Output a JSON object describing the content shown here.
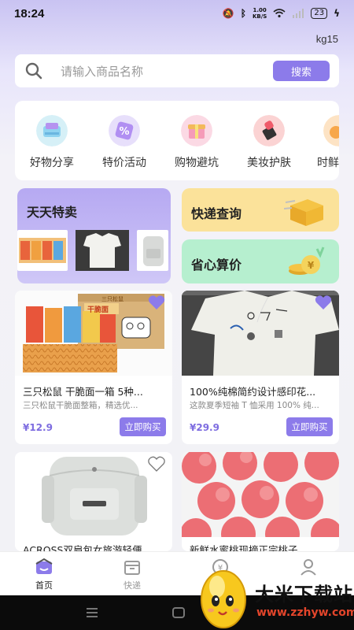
{
  "status": {
    "time": "18:24",
    "speed_value": "1.00",
    "speed_unit": "KB/S",
    "battery": "23"
  },
  "header": {
    "username": "kg15"
  },
  "search": {
    "placeholder": "请输入商品名称",
    "button": "搜索"
  },
  "categories": [
    {
      "label": "好物分享",
      "icon": "basket-icon"
    },
    {
      "label": "特价活动",
      "icon": "percent-tag-icon"
    },
    {
      "label": "购物避坑",
      "icon": "gift-box-icon"
    },
    {
      "label": "美妆护肤",
      "icon": "lipstick-icon"
    },
    {
      "label": "时鲜",
      "icon": "fresh-food-icon"
    }
  ],
  "features": {
    "daily": "天天特卖",
    "express": "快递查询",
    "save": "省心算价"
  },
  "products": [
    {
      "title": "三只松鼠 干脆面一箱 5种...",
      "desc": "三只松鼠干脆面整箱，精选优...",
      "price": "¥12.9",
      "buy": "立即购买",
      "img_label": "三只松鼠",
      "img_sub": "干脆面"
    },
    {
      "title": "100%纯棉简约设计感印花...",
      "desc": "这款夏季短袖 T 恤采用 100% 纯...",
      "price": "¥29.9",
      "buy": "立即购买"
    },
    {
      "title": "ACROSS双肩包女旅游轻便..."
    },
    {
      "title": "新鲜水蜜桃现摘正宗桃子..."
    }
  ],
  "tabbar": [
    {
      "label": "首页",
      "active": true
    },
    {
      "label": "快递",
      "active": false
    },
    {
      "label": "",
      "active": false
    },
    {
      "label": "",
      "active": false
    }
  ],
  "watermark": {
    "text": "大米下载站",
    "url": "www.zzhyw.com"
  },
  "colors": {
    "accent": "#8c7bea",
    "price": "#7d6ce0",
    "express_bg": "#fbe29a",
    "save_bg": "#b6efcf"
  }
}
